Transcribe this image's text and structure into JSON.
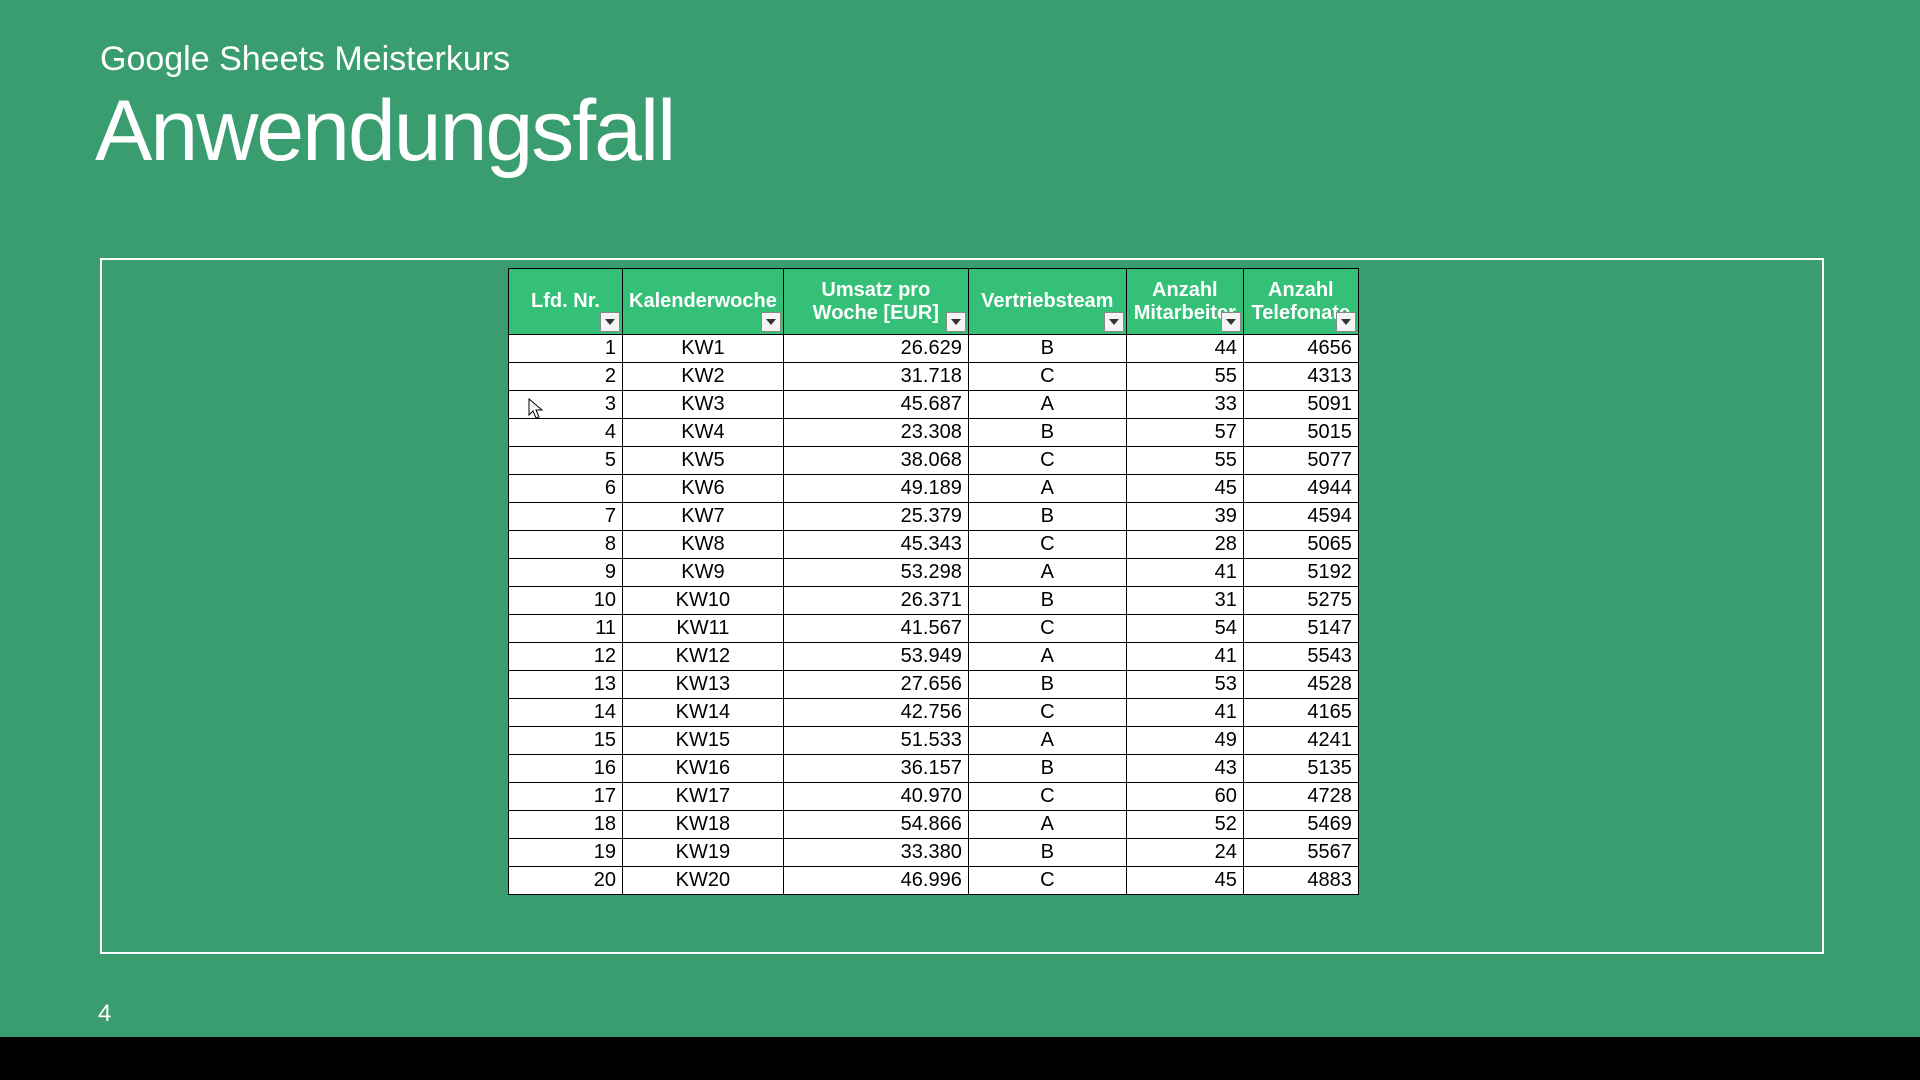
{
  "slide": {
    "subtitle": "Google Sheets Meisterkurs",
    "title": "Anwendungsfall",
    "page_number": "4"
  },
  "table": {
    "headers": [
      "Lfd. Nr.",
      "Kalenderwoche",
      "Umsatz pro Woche [EUR]",
      "Vertriebsteam",
      "Anzahl Mitarbeiter",
      "Anzahl Telefonate"
    ],
    "rows": [
      {
        "n": "1",
        "kw": "KW1",
        "um": "26.629",
        "vt": "B",
        "ma": "44",
        "te": "4656"
      },
      {
        "n": "2",
        "kw": "KW2",
        "um": "31.718",
        "vt": "C",
        "ma": "55",
        "te": "4313"
      },
      {
        "n": "3",
        "kw": "KW3",
        "um": "45.687",
        "vt": "A",
        "ma": "33",
        "te": "5091"
      },
      {
        "n": "4",
        "kw": "KW4",
        "um": "23.308",
        "vt": "B",
        "ma": "57",
        "te": "5015"
      },
      {
        "n": "5",
        "kw": "KW5",
        "um": "38.068",
        "vt": "C",
        "ma": "55",
        "te": "5077"
      },
      {
        "n": "6",
        "kw": "KW6",
        "um": "49.189",
        "vt": "A",
        "ma": "45",
        "te": "4944"
      },
      {
        "n": "7",
        "kw": "KW7",
        "um": "25.379",
        "vt": "B",
        "ma": "39",
        "te": "4594"
      },
      {
        "n": "8",
        "kw": "KW8",
        "um": "45.343",
        "vt": "C",
        "ma": "28",
        "te": "5065"
      },
      {
        "n": "9",
        "kw": "KW9",
        "um": "53.298",
        "vt": "A",
        "ma": "41",
        "te": "5192"
      },
      {
        "n": "10",
        "kw": "KW10",
        "um": "26.371",
        "vt": "B",
        "ma": "31",
        "te": "5275"
      },
      {
        "n": "11",
        "kw": "KW11",
        "um": "41.567",
        "vt": "C",
        "ma": "54",
        "te": "5147"
      },
      {
        "n": "12",
        "kw": "KW12",
        "um": "53.949",
        "vt": "A",
        "ma": "41",
        "te": "5543"
      },
      {
        "n": "13",
        "kw": "KW13",
        "um": "27.656",
        "vt": "B",
        "ma": "53",
        "te": "4528"
      },
      {
        "n": "14",
        "kw": "KW14",
        "um": "42.756",
        "vt": "C",
        "ma": "41",
        "te": "4165"
      },
      {
        "n": "15",
        "kw": "KW15",
        "um": "51.533",
        "vt": "A",
        "ma": "49",
        "te": "4241"
      },
      {
        "n": "16",
        "kw": "KW16",
        "um": "36.157",
        "vt": "B",
        "ma": "43",
        "te": "5135"
      },
      {
        "n": "17",
        "kw": "KW17",
        "um": "40.970",
        "vt": "C",
        "ma": "60",
        "te": "4728"
      },
      {
        "n": "18",
        "kw": "KW18",
        "um": "54.866",
        "vt": "A",
        "ma": "52",
        "te": "5469"
      },
      {
        "n": "19",
        "kw": "KW19",
        "um": "33.380",
        "vt": "B",
        "ma": "24",
        "te": "5567"
      },
      {
        "n": "20",
        "kw": "KW20",
        "um": "46.996",
        "vt": "C",
        "ma": "45",
        "te": "4883"
      }
    ]
  }
}
